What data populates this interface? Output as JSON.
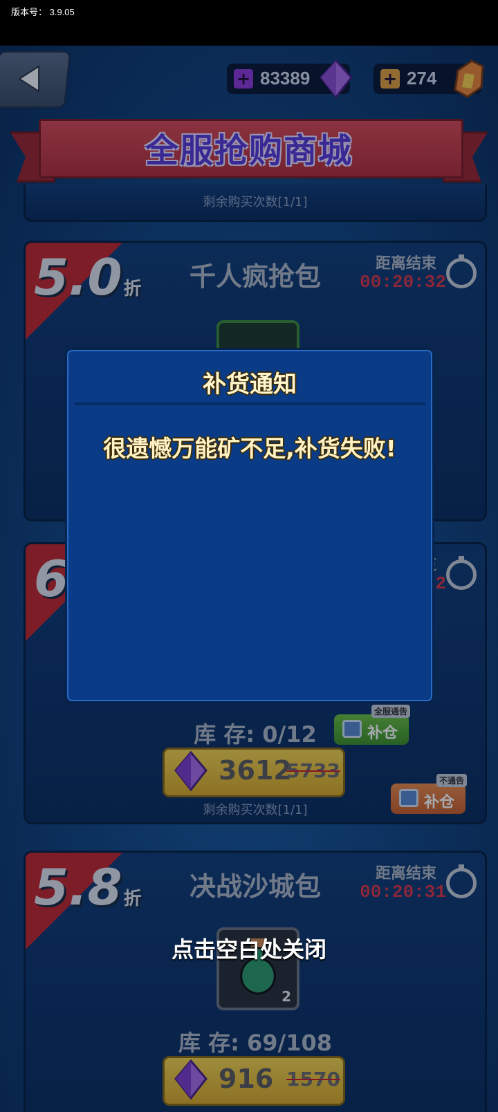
{
  "version_bar": {
    "text": "版本号： 3.9.05"
  },
  "header": {
    "gem_count": "83389",
    "ore_count": "274",
    "title": "全服抢购商城"
  },
  "prev_card": {
    "remain": "剩余购买次数[1/1]"
  },
  "card1": {
    "discount": "5.0",
    "discount_unit": "折",
    "name": "千人疯抢包",
    "end_label": "距离结束",
    "timer": "00:20:32"
  },
  "card2": {
    "discount": "6",
    "end_label": "束",
    "timer": "2",
    "stock": "库 存: 0/12",
    "restock_all_tag": "全服通告",
    "restock_all_label": "补仓",
    "price": "3612",
    "orig_price": "5733",
    "restock_silent_tag": "不通告",
    "restock_silent_label": "补仓",
    "remain": "剩余购买次数[1/1]"
  },
  "card3": {
    "discount": "5.8",
    "discount_unit": "折",
    "name": "决战沙城包",
    "end_label": "距离结束",
    "timer": "00:20:31",
    "item_count": "2",
    "stock": "库 存: 69/108",
    "price": "916",
    "orig_price": "1570"
  },
  "dialog": {
    "title": "补货通知",
    "message": "很遗憾万能矿不足,补货失败!"
  },
  "close_hint": "点击空白处关闭",
  "colors": {
    "accent_red": "#c0282e",
    "dialog_bg": "#0a3b86",
    "price_btn": "#f2d34d"
  }
}
